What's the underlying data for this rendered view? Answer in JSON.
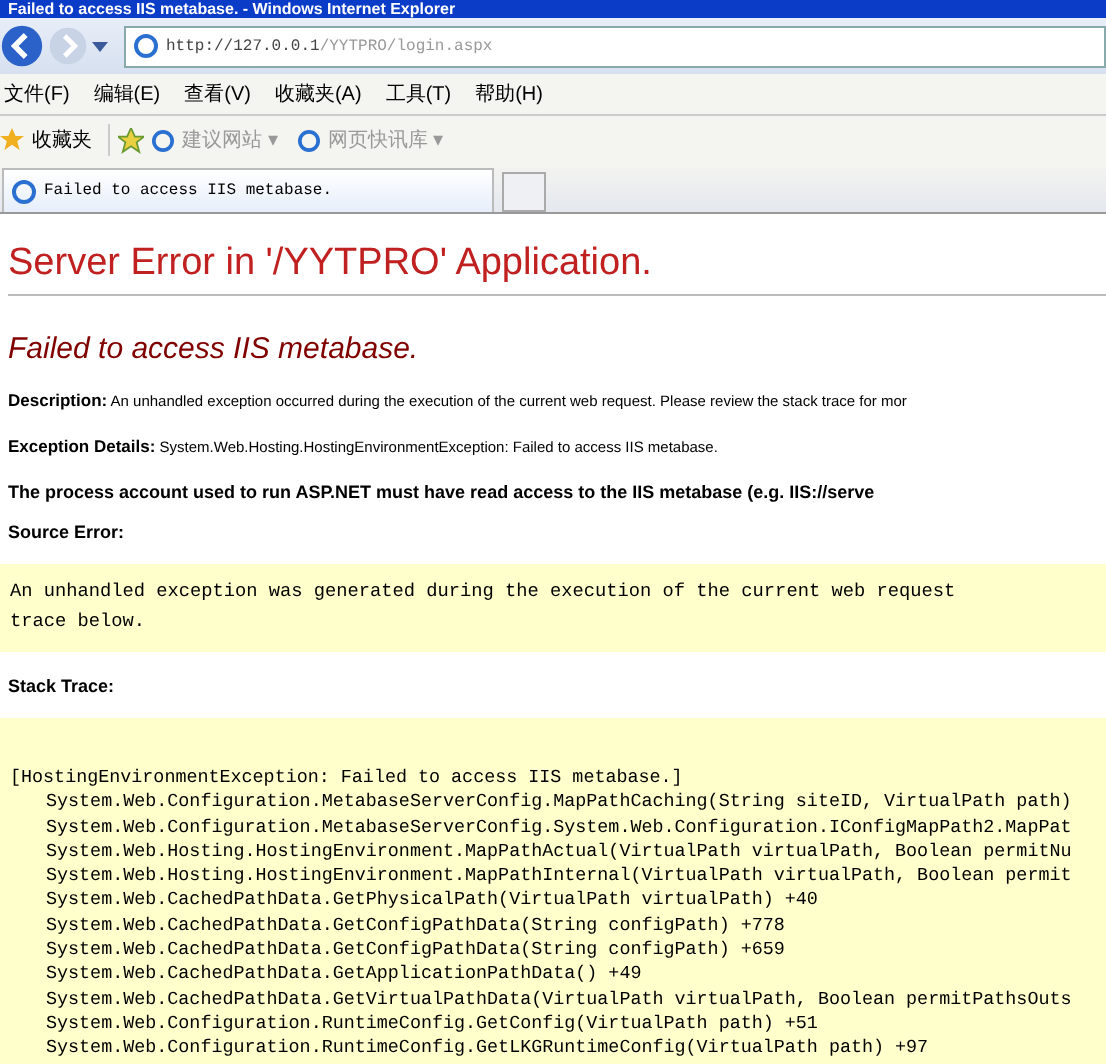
{
  "window": {
    "title": "Failed to access IIS metabase. - Windows Internet Explorer"
  },
  "address_bar": {
    "url_host": "http://127.0.0.1",
    "url_path": "/YYTPRO/login.aspx"
  },
  "menu": [
    "文件(F)",
    "编辑(E)",
    "查看(V)",
    "收藏夹(A)",
    "工具(T)",
    "帮助(H)"
  ],
  "favorites_bar": {
    "favorites": "收藏夹",
    "links": [
      "建议网站 ▾",
      "网页快讯库 ▾"
    ]
  },
  "tabs": [
    {
      "label": "Failed to access IIS metabase.",
      "selected": true
    }
  ],
  "page": {
    "heading": "Server Error in '/YYTPRO' Application.",
    "error_title": "Failed to access IIS metabase.",
    "description_label": "Description:",
    "description": "An unhandled exception occurred during the execution of the current web request. Please review the stack trace for mor",
    "exception_label": "Exception Details:",
    "exception": "System.Web.Hosting.HostingEnvironmentException: Failed to access IIS metabase.",
    "process_note": "The process account used to run ASP.NET must have read access to the IIS metabase (e.g. IIS://serve",
    "source_error_label": "Source Error:",
    "source_error": [
      "An unhandled exception was generated during the execution of the current web request",
      "trace below."
    ],
    "stack_trace_label": "Stack Trace:",
    "stack_trace_header": "[HostingEnvironmentException: Failed to access IIS metabase.]",
    "stack_trace": [
      "System.Web.Configuration.MetabaseServerConfig.MapPathCaching(String siteID, VirtualPath path)",
      "System.Web.Configuration.MetabaseServerConfig.System.Web.Configuration.IConfigMapPath2.MapPat",
      "System.Web.Hosting.HostingEnvironment.MapPathActual(VirtualPath virtualPath, Boolean permitNu",
      "System.Web.Hosting.HostingEnvironment.MapPathInternal(VirtualPath virtualPath, Boolean permit",
      "System.Web.CachedPathData.GetPhysicalPath(VirtualPath virtualPath) +40",
      "System.Web.CachedPathData.GetConfigPathData(String configPath) +778",
      "System.Web.CachedPathData.GetConfigPathData(String configPath) +659",
      "System.Web.CachedPathData.GetApplicationPathData() +49",
      "System.Web.CachedPathData.GetVirtualPathData(VirtualPath virtualPath, Boolean permitPathsOuts",
      "System.Web.Configuration.RuntimeConfig.GetConfig(VirtualPath path) +51",
      "System.Web.Configuration.RuntimeConfig.GetLKGRuntimeConfig(VirtualPath path) +97"
    ]
  }
}
